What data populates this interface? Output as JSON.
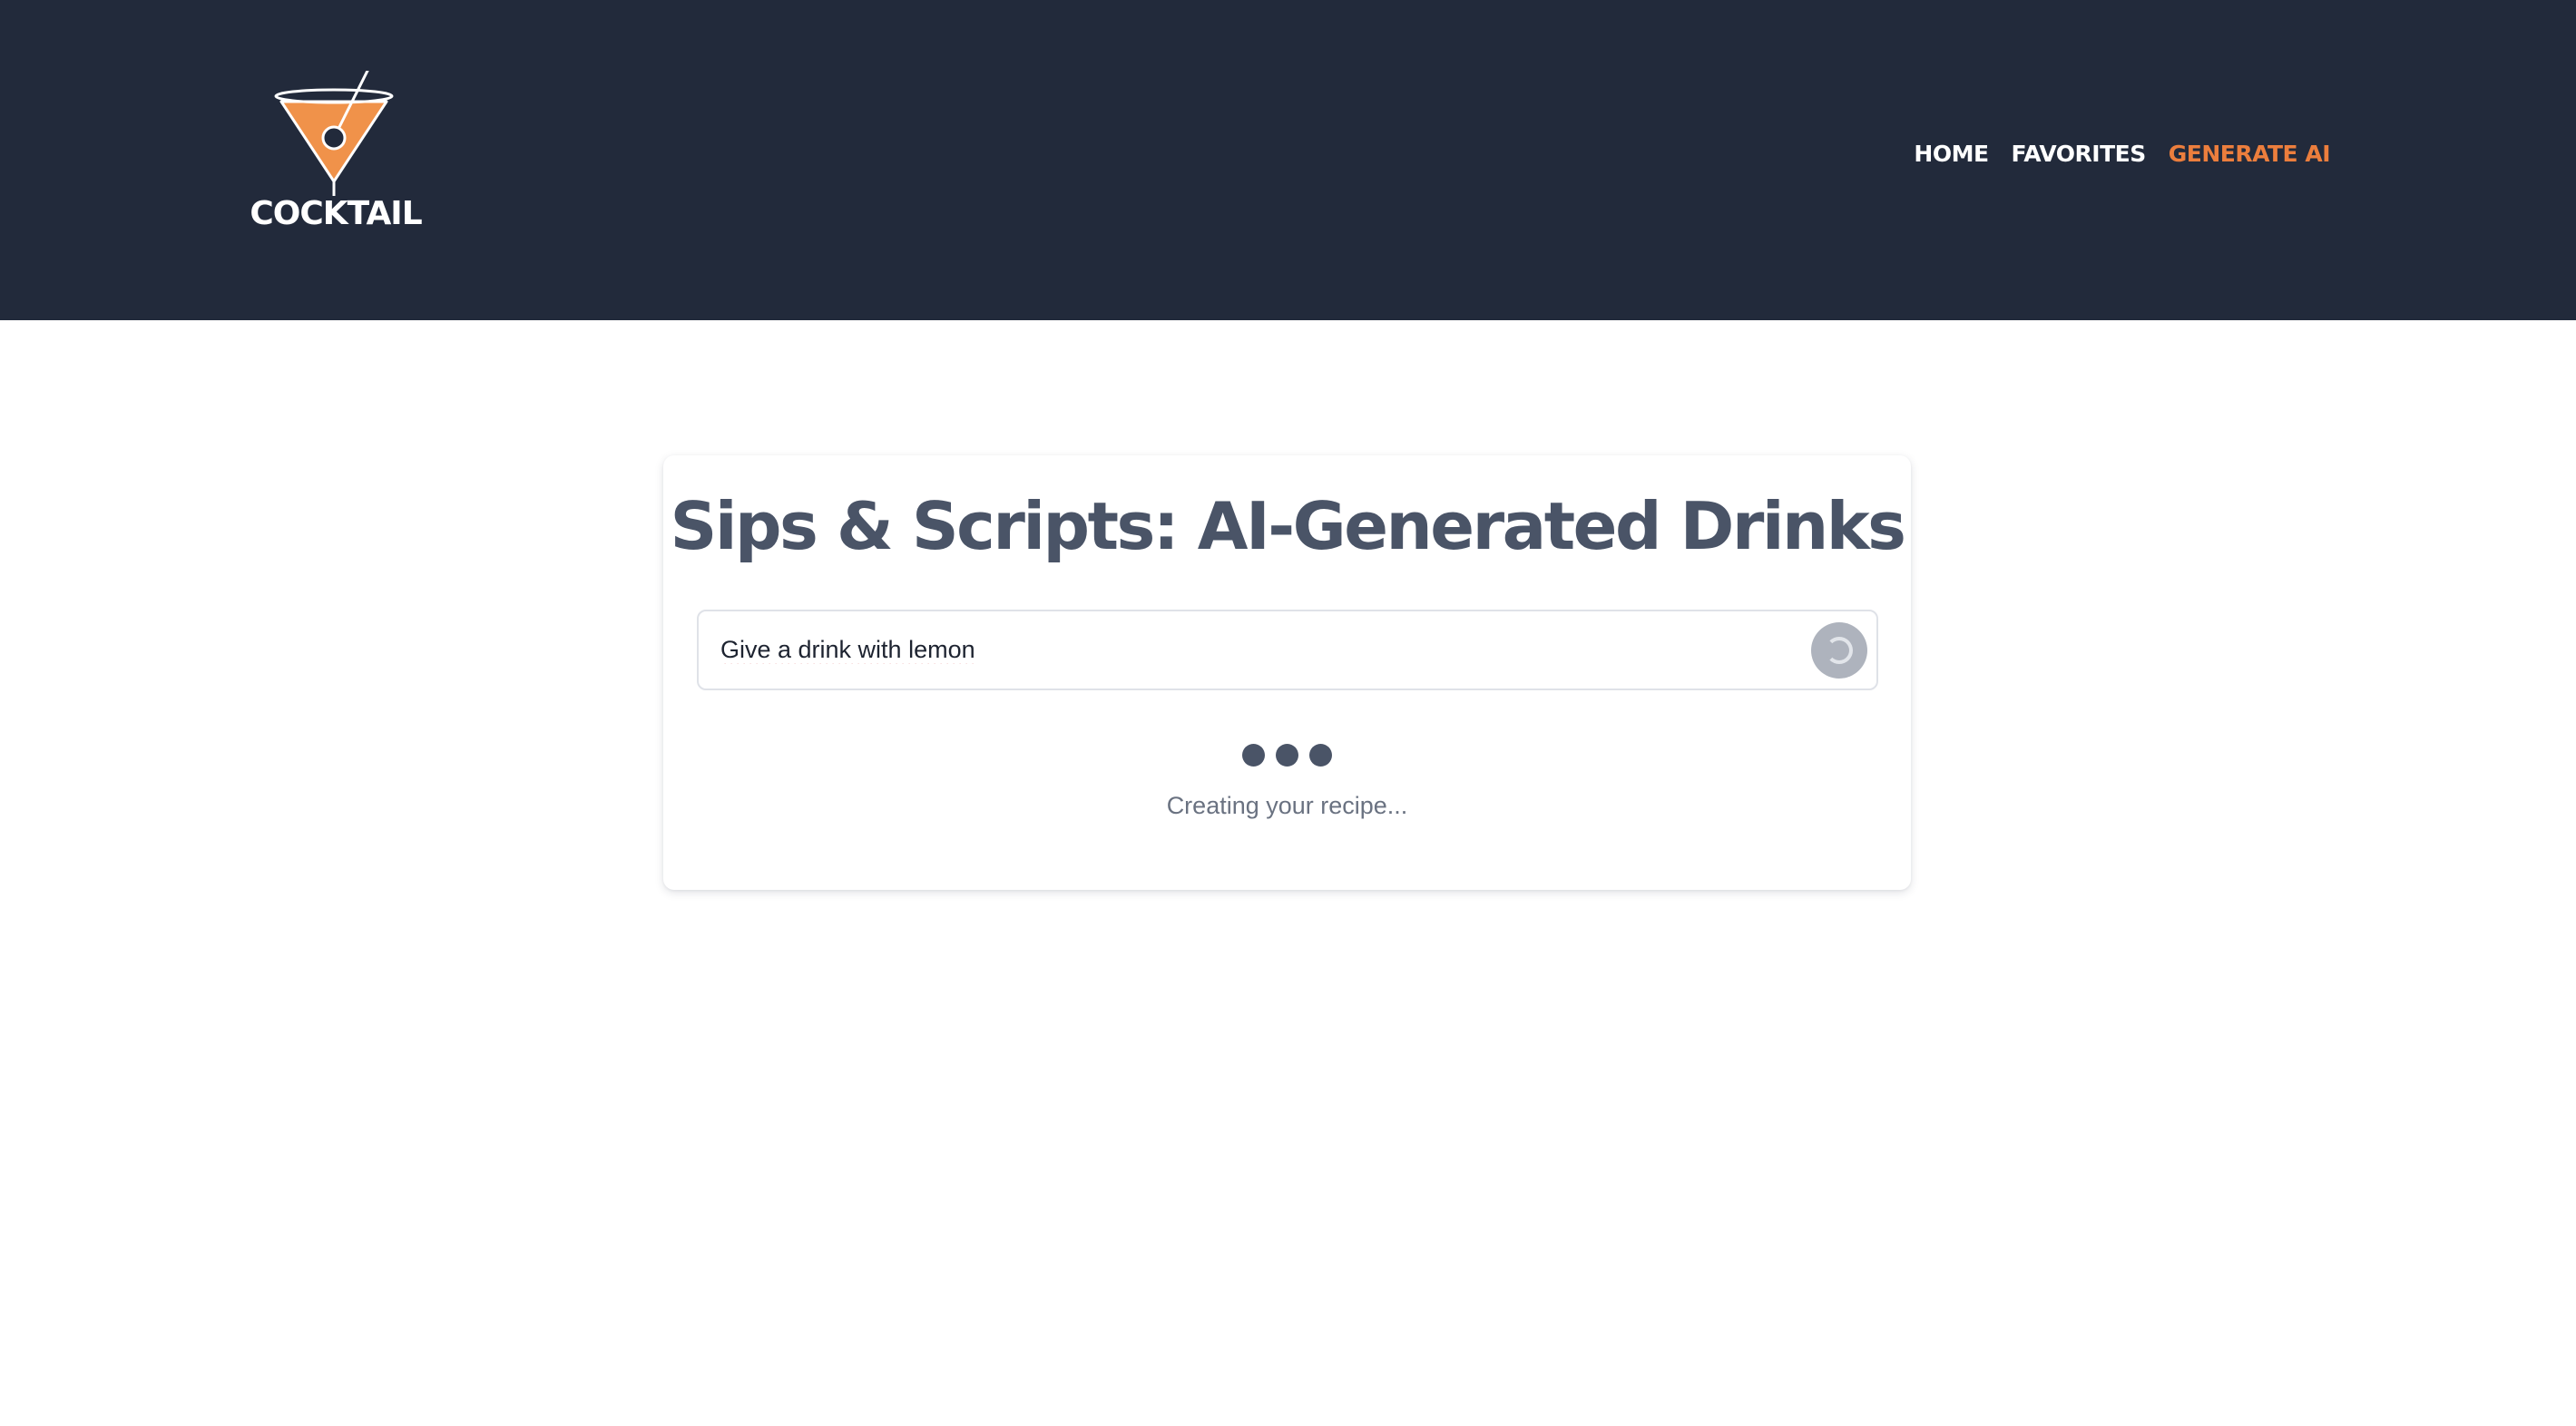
{
  "header": {
    "brand": {
      "name": "COCKTAIL",
      "icon": "cocktail-glass-icon"
    },
    "nav": [
      {
        "label": "HOME",
        "active": false
      },
      {
        "label": "FAVORITES",
        "active": false
      },
      {
        "label": "GENERATE AI",
        "active": true
      }
    ]
  },
  "main": {
    "title": "Sips & Scripts: AI-Generated Drinks",
    "prompt": {
      "value": "Give a drink with lemon",
      "button_icon": "loading-spinner-icon"
    },
    "loading": {
      "indicator_icon": "typing-dots-icon",
      "text": "Creating your recipe..."
    }
  },
  "colors": {
    "header_bg": "#222a3b",
    "accent": "#ec7e3d",
    "title": "#4a5467",
    "muted_text": "#6a7281"
  }
}
